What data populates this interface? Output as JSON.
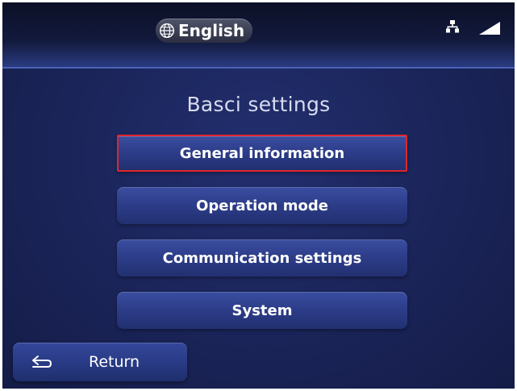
{
  "header": {
    "language_label": "English",
    "icons": {
      "language": "globe-icon",
      "network": "network-icon",
      "signal": "signal-icon"
    }
  },
  "main": {
    "title": "Basci settings",
    "menu": [
      {
        "label": "General information",
        "selected": true
      },
      {
        "label": "Operation mode",
        "selected": false
      },
      {
        "label": "Communication settings",
        "selected": false
      },
      {
        "label": "System",
        "selected": false
      }
    ]
  },
  "footer": {
    "return_label": "Return",
    "return_icon": "back-arrow-icon"
  },
  "colors": {
    "background": "#1a2458",
    "button": "#2c3c88",
    "selection_border": "#e0262e",
    "text": "#ffffff"
  }
}
